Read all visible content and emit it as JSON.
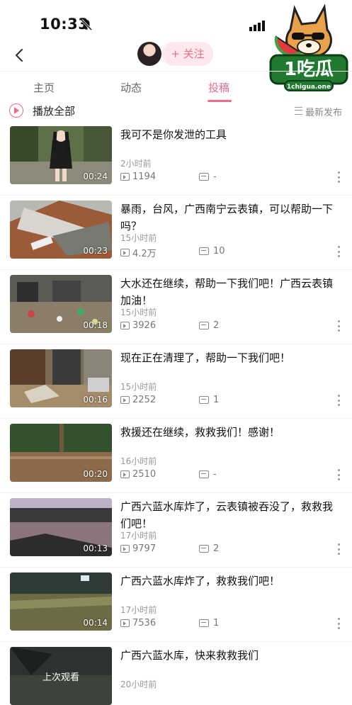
{
  "status": {
    "time": "10:33"
  },
  "header": {
    "follow_label": "+ 关注",
    "logo_text": "1吃瓜",
    "logo_domain": "1chigua.one"
  },
  "tabs": [
    {
      "label": "主页",
      "active": false
    },
    {
      "label": "动态",
      "active": false
    },
    {
      "label": "投稿",
      "active": true
    }
  ],
  "play_all_label": "播放全部",
  "sort_label": "最新发布",
  "colors": {
    "accent": "#f06a8a"
  },
  "videos": [
    {
      "title": "我可不是你发泄的工具",
      "time_ago": "2小时前",
      "plays": "1194",
      "comments": "-",
      "duration": "00:24",
      "thumb": "girl-park"
    },
    {
      "title": "暴雨，台风，广西南宁云表镇，可以帮助一下吗？",
      "time_ago": "15小时前",
      "plays": "4.2万",
      "comments": "10",
      "duration": "00:23",
      "thumb": "collapsed-house"
    },
    {
      "title": "大水还在继续，帮助一下我们吧！广西云表镇加油！",
      "time_ago": "15小时前",
      "plays": "3926",
      "comments": "2",
      "duration": "00:18",
      "thumb": "flood-debris-street"
    },
    {
      "title": "现在正在清理了，帮助一下我们吧！",
      "time_ago": "15小时前",
      "plays": "2252",
      "comments": "1",
      "duration": "00:16",
      "thumb": "mud-cleanup"
    },
    {
      "title": "救援还在继续，救救我们！感谢！",
      "time_ago": "16小时前",
      "plays": "2510",
      "comments": "-",
      "duration": "00:20",
      "thumb": "flooded-field"
    },
    {
      "title": "广西六蓝水库炸了，云表镇被吞没了，救救我们吧！",
      "time_ago": "17小时前",
      "plays": "9797",
      "comments": "2",
      "duration": "00:13",
      "thumb": "dusk-flood"
    },
    {
      "title": "广西六蓝水库炸了，救救我们吧！",
      "time_ago": "17小时前",
      "plays": "7536",
      "comments": "1",
      "duration": "00:14",
      "thumb": "night-flood"
    },
    {
      "title": "广西六蓝水库，快来救救我们",
      "time_ago": "20小时前",
      "plays": "",
      "comments": "",
      "duration": "",
      "thumb": "last-watched",
      "overlay": "上次观看"
    }
  ]
}
